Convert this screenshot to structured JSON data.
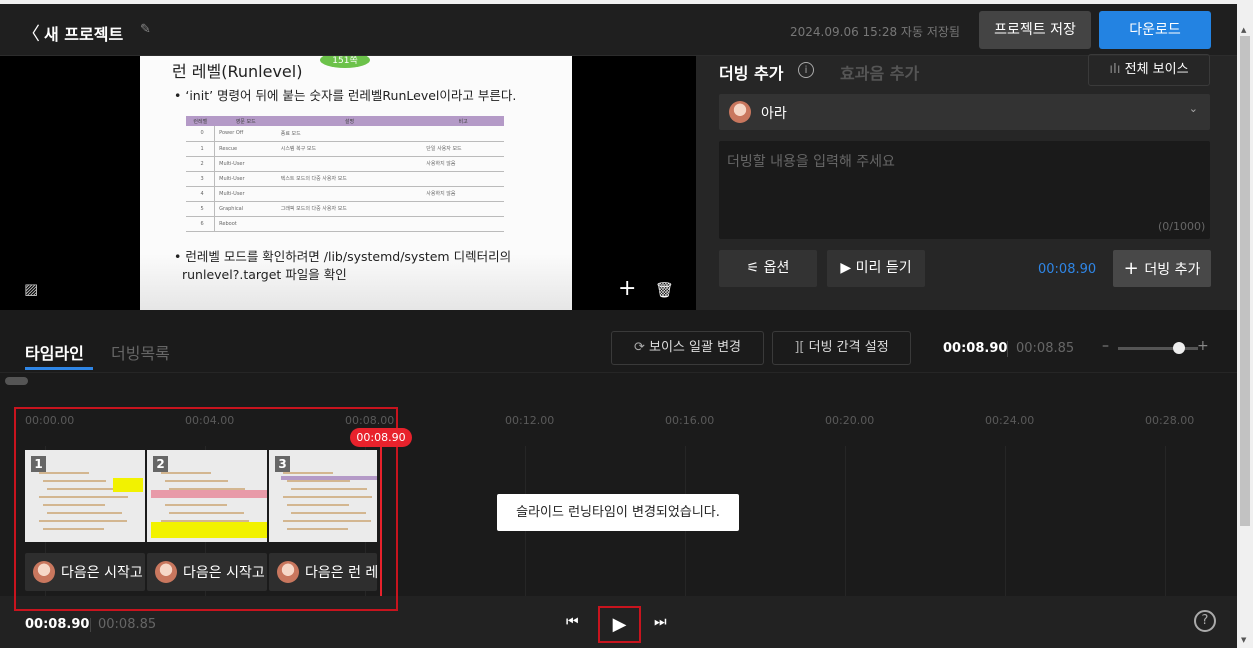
{
  "header": {
    "back_icon": "chevron-left-icon",
    "title": "새 프로젝트",
    "autosave": "2024.09.06 15:28 자동 저장됨",
    "save_label": "프로젝트 저장",
    "download_label": "다운로드"
  },
  "slide": {
    "heading": "런 레벨(Runlevel)",
    "badge": "151쪽",
    "bullet1": "• ‘init’ 명령어 뒤에 붙는 숫자를 런레벨RunLevel이라고 부른다.",
    "table_headers": [
      "런레벨",
      "영문 모드",
      "설명",
      "비고"
    ],
    "table_rows": [
      [
        "0",
        "Power Off",
        "종료 모드",
        ""
      ],
      [
        "1",
        "Rescue",
        "시스템 복구 모드",
        "단일 사용자 모드"
      ],
      [
        "2",
        "Multi-User",
        "",
        "사용하지 않음"
      ],
      [
        "3",
        "Multi-User",
        "텍스트 모드의 다중 사용자 모드",
        ""
      ],
      [
        "4",
        "Multi-User",
        "",
        "사용하지 않음"
      ],
      [
        "5",
        "Graphical",
        "그래픽 모드의 다중 사용자 모드",
        ""
      ],
      [
        "6",
        "Reboot",
        "",
        ""
      ]
    ],
    "bullet2_line1": "• 런레벨 모드를 확인하려면 /lib/systemd/system 디렉터리의",
    "bullet2_line2": "runlevel?.target 파일을 확인"
  },
  "dub_panel": {
    "tab_dub": "더빙 추가",
    "tab_sfx": "효과음 추가",
    "all_voice": "전체 보이스",
    "voice_name": "아라",
    "placeholder": "더빙할 내용을 입력해 주세요",
    "char_count": "(0/1000)",
    "option_label": "옵션",
    "preview_label": "미리 듣기",
    "time": "00:08.90",
    "add_label": "더빙 추가"
  },
  "tabs": {
    "timeline": "타임라인",
    "dub_list": "더빙목록",
    "batch_voice": "보이스 일괄 변경",
    "gap_setting": "더빙 간격 설정",
    "current_time": "00:08.90",
    "total_time": "00:08.85",
    "zoom_level": 0.85
  },
  "timeline": {
    "ticks": [
      "00:00.00",
      "00:04.00",
      "00:08.00",
      "00:12.00",
      "00:16.00",
      "00:20.00",
      "00:24.00",
      "00:28.00"
    ],
    "playhead": "00:08.90",
    "slides": [
      {
        "num": "1",
        "dub": "다음은 시작고"
      },
      {
        "num": "2",
        "dub": "다음은 시작고"
      },
      {
        "num": "3",
        "dub": "다음은 런 레"
      }
    ],
    "toast": "슬라이드 런닝타임이 변경되었습니다."
  },
  "bottom": {
    "current_time": "00:08.90",
    "total_time": "00:08.85",
    "help": "?"
  },
  "colors": {
    "accent": "#2383e2",
    "playhead": "#e8222c",
    "highlight": "#c8141e"
  }
}
